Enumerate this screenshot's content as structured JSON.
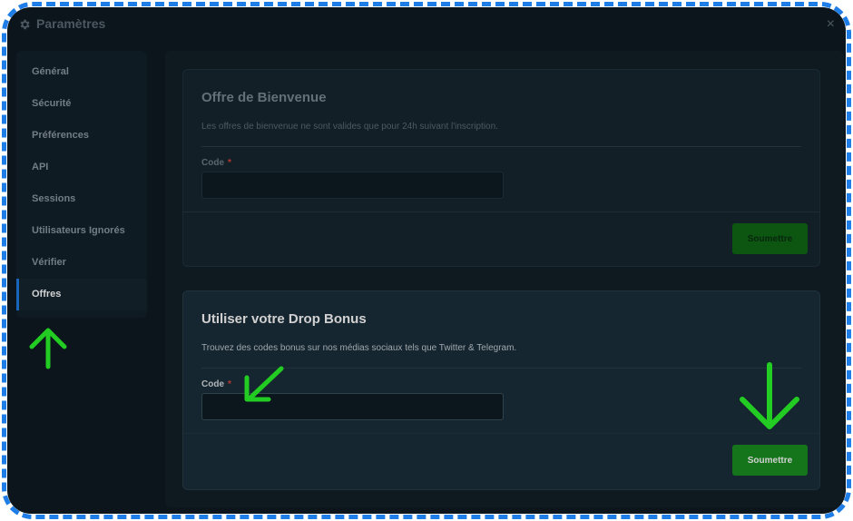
{
  "window": {
    "title": "Paramètres"
  },
  "sidebar": {
    "items": [
      {
        "label": "Général",
        "active": false
      },
      {
        "label": "Sécurité",
        "active": false
      },
      {
        "label": "Préférences",
        "active": false
      },
      {
        "label": "API",
        "active": false
      },
      {
        "label": "Sessions",
        "active": false
      },
      {
        "label": "Utilisateurs Ignorés",
        "active": false
      },
      {
        "label": "Vérifier",
        "active": false
      },
      {
        "label": "Offres",
        "active": true
      }
    ]
  },
  "welcome_offer": {
    "title": "Offre de Bienvenue",
    "description": "Les offres de bienvenue ne sont valides que pour 24h suivant l'inscription.",
    "code_label": "Code",
    "required_mark": "*",
    "code_value": "",
    "submit_label": "Soumettre"
  },
  "drop_bonus": {
    "title": "Utiliser votre Drop Bonus",
    "description": "Trouvez des codes bonus sur nos médias sociaux tels que Twitter & Telegram.",
    "code_label": "Code",
    "required_mark": "*",
    "code_value": "",
    "submit_label": "Soumettre"
  },
  "colors": {
    "frame_border": "#1e7de6",
    "active_indicator": "#1e7de6",
    "submit_active": "#1a8f22",
    "annotation_arrow": "#22cc22"
  },
  "icons": {
    "title": "gear-icon",
    "close": "close-icon",
    "annotations": [
      "arrow-up-icon",
      "arrow-down-left-icon",
      "arrow-down-icon"
    ]
  }
}
